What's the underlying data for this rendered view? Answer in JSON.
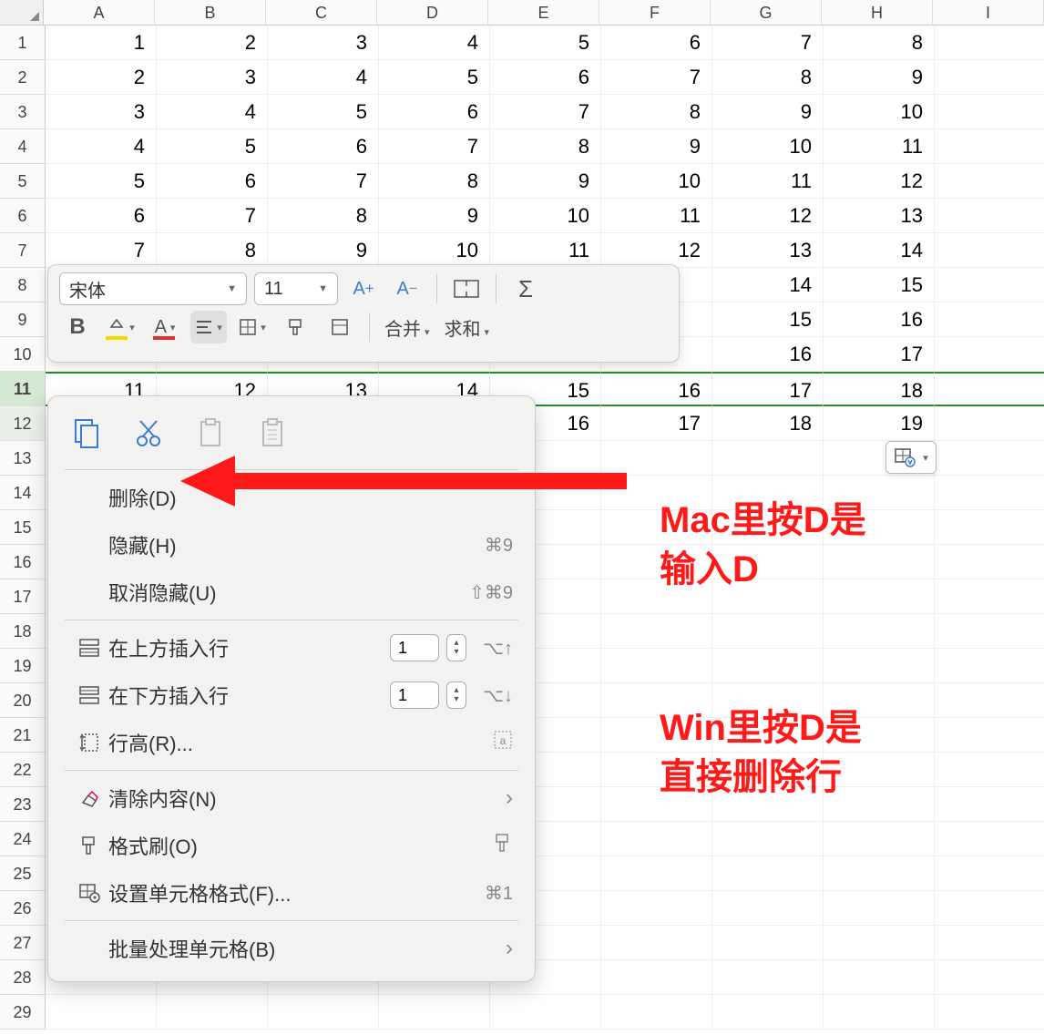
{
  "columns": [
    "A",
    "B",
    "C",
    "D",
    "E",
    "F",
    "G",
    "H",
    "I"
  ],
  "rows": [
    1,
    2,
    3,
    4,
    5,
    6,
    7,
    8,
    9,
    10,
    11,
    12,
    13,
    14,
    15,
    16,
    17,
    18,
    19,
    20,
    21,
    22,
    23,
    24,
    25,
    26,
    27,
    28,
    29
  ],
  "selected_row": 11,
  "grid": [
    [
      "1",
      "2",
      "3",
      "4",
      "5",
      "6",
      "7",
      "8",
      ""
    ],
    [
      "2",
      "3",
      "4",
      "5",
      "6",
      "7",
      "8",
      "9",
      ""
    ],
    [
      "3",
      "4",
      "5",
      "6",
      "7",
      "8",
      "9",
      "10",
      ""
    ],
    [
      "4",
      "5",
      "6",
      "7",
      "8",
      "9",
      "10",
      "11",
      ""
    ],
    [
      "5",
      "6",
      "7",
      "8",
      "9",
      "10",
      "11",
      "12",
      ""
    ],
    [
      "6",
      "7",
      "8",
      "9",
      "10",
      "11",
      "12",
      "13",
      ""
    ],
    [
      "7",
      "8",
      "9",
      "10",
      "11",
      "12",
      "13",
      "14",
      ""
    ],
    [
      "",
      "",
      "",
      "",
      "",
      "",
      "14",
      "15",
      ""
    ],
    [
      "",
      "",
      "",
      "",
      "",
      "",
      "15",
      "16",
      ""
    ],
    [
      "",
      "",
      "",
      "",
      "",
      "",
      "16",
      "17",
      ""
    ],
    [
      "11",
      "12",
      "13",
      "14",
      "15",
      "16",
      "17",
      "18",
      ""
    ],
    [
      "",
      "",
      "",
      "",
      "16",
      "17",
      "18",
      "19",
      ""
    ]
  ],
  "toolbar": {
    "font_name": "宋体",
    "font_size": "11",
    "merge_label": "合并",
    "sum_label": "求和"
  },
  "toolbar_icons": {
    "bold": "B",
    "grow_font": "A⁺",
    "shrink_font": "A⁻"
  },
  "context_menu": {
    "delete": "删除(D)",
    "hide": "隐藏(H)",
    "hide_kb": "⌘9",
    "unhide": "取消隐藏(U)",
    "unhide_kb": "⇧⌘9",
    "insert_above": "在上方插入行",
    "insert_above_val": "1",
    "insert_above_kb": "⌥↑",
    "insert_below": "在下方插入行",
    "insert_below_val": "1",
    "insert_below_kb": "⌥↓",
    "row_height": "行高(R)...",
    "clear": "清除内容(N)",
    "format_painter": "格式刷(O)",
    "cell_format": "设置单元格格式(F)...",
    "cell_format_kb": "⌘1",
    "batch": "批量处理单元格(B)"
  },
  "annotations": {
    "mac_line1": "Mac里按D是",
    "mac_line2": "输入D",
    "win_line1": "Win里按D是",
    "win_line2": "直接删除行"
  }
}
